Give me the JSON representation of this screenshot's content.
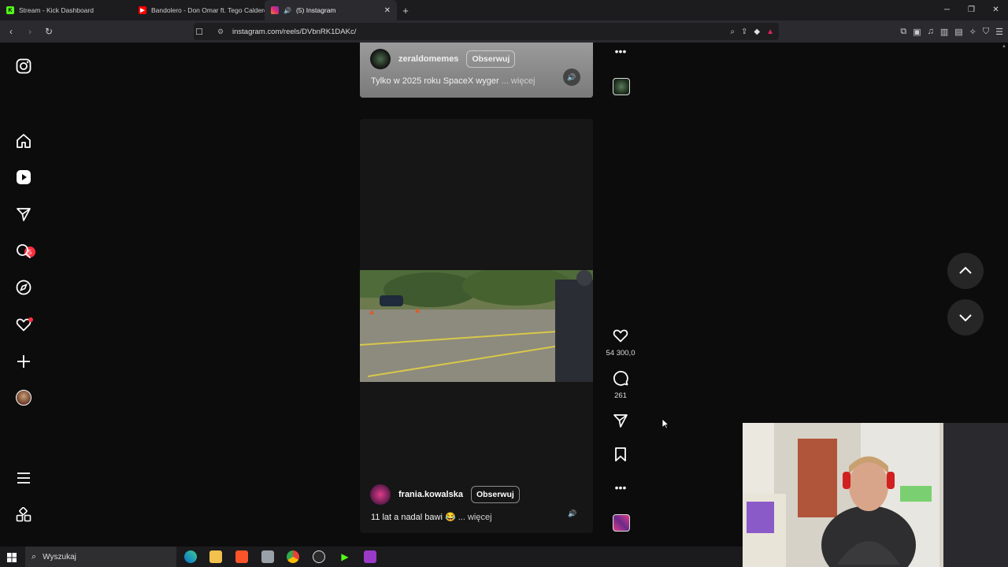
{
  "browser": {
    "tabs": [
      {
        "title": "Stream - Kick Dashboard",
        "active": false
      },
      {
        "title": "Bandolero - Don Omar ft. Tego Calderón",
        "active": false
      },
      {
        "title": "(5) Instagram",
        "active": true
      }
    ],
    "url": "instagram.com/reels/DVbnRK1DAKc/"
  },
  "sidebar": {
    "notification_badge": "5",
    "items": [
      "instagram-logo",
      "home",
      "reels",
      "messages",
      "search",
      "explore",
      "notifications",
      "create",
      "profile",
      "menu",
      "more"
    ]
  },
  "reels": [
    {
      "username": "zeraldomemes",
      "follow_label": "Obserwuj",
      "caption": "Tylko w 2025 roku SpaceX wyger",
      "more_label": "... więcej"
    },
    {
      "username": "frania.kowalska",
      "follow_label": "Obserwuj",
      "caption": "11 lat a nadal bawi 😂",
      "more_label": "... więcej",
      "likes": "54 300,0",
      "comments": "261"
    }
  ],
  "taskbar": {
    "search_placeholder": "Wyszukaj"
  },
  "colors": {
    "background": "#0c0c0c",
    "badge": "#ff3040",
    "surface": "#262626"
  }
}
